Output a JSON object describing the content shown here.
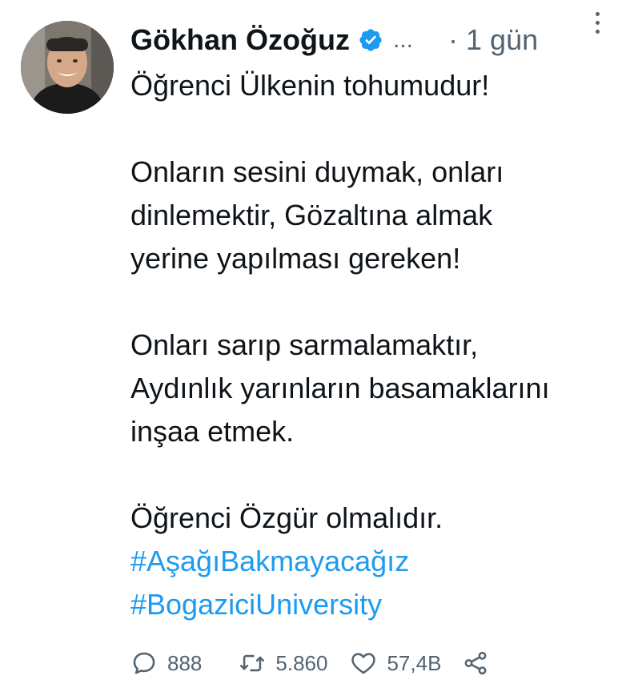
{
  "author": {
    "name": "Gökhan Özoğuz",
    "truncation": "...",
    "time_separator": "·",
    "time": "1 gün"
  },
  "body": {
    "paragraph1": "Öğrenci Ülkenin tohumudur!",
    "paragraph2": "Onların sesini duymak, onları dinlemektir, Gözaltına almak yerine yapılması gereken!",
    "paragraph3": "Onları sarıp sarmalamaktır, Aydınlık yarınların basamaklarını inşaa etmek.",
    "paragraph4": "Öğrenci Özgür olmalıdır.",
    "hashtags": [
      "#AşağıBakmayacağız",
      "#BogaziciUniversity"
    ]
  },
  "stats": {
    "replies": "888",
    "retweets": "5.860",
    "likes": "57,4B"
  },
  "icons": {
    "verified": "verified-badge-icon",
    "more": "more-vertical-icon",
    "reply": "reply-icon",
    "retweet": "retweet-icon",
    "like": "heart-icon",
    "share": "share-icon"
  },
  "colors": {
    "accent": "#1d9bf0",
    "text": "#0f1419",
    "muted": "#536471"
  }
}
